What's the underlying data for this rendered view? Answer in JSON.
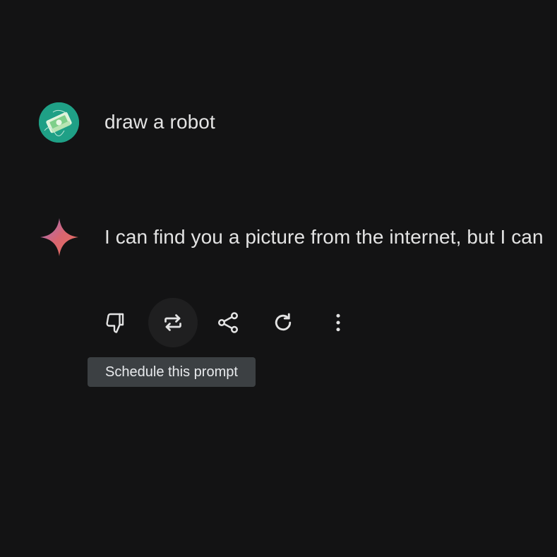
{
  "conversation": {
    "user_message": "draw a robot",
    "model_message": "I can find you a picture from the internet, but I can"
  },
  "actions": {
    "items": [
      {
        "icon": "thumb-down-icon"
      },
      {
        "icon": "repeat-icon"
      },
      {
        "icon": "share-icon"
      },
      {
        "icon": "regenerate-icon"
      },
      {
        "icon": "more-vert-icon"
      }
    ]
  },
  "tooltip": {
    "text": "Schedule this prompt"
  },
  "colors": {
    "background": "#131314",
    "text": "#e3e3e3",
    "avatar": "#1fa086",
    "tooltip_bg": "#3c4043",
    "hover_bg": "#1f1f20"
  }
}
